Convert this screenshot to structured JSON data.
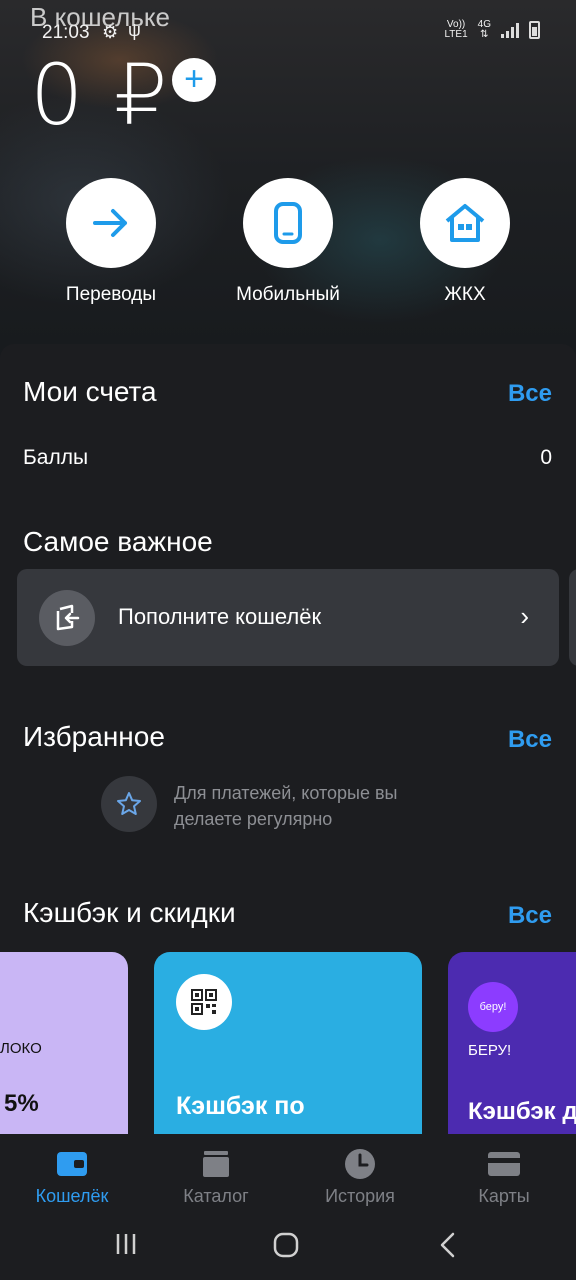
{
  "status_bar": {
    "time": "21:03",
    "network_top": "Vo))",
    "network_bottom": "LTE1",
    "net_type": "4G"
  },
  "header": {
    "caption": "В кошельке",
    "balance": "0 ₽"
  },
  "quick_actions": [
    {
      "label": "Переводы",
      "icon": "arrow-right-icon"
    },
    {
      "label": "Мобильный",
      "icon": "phone-icon"
    },
    {
      "label": "ЖКХ",
      "icon": "house-icon"
    }
  ],
  "accounts": {
    "title": "Мои счета",
    "all": "Все",
    "rows": [
      {
        "label": "Баллы",
        "value": "0"
      }
    ]
  },
  "important": {
    "title": "Самое важное",
    "card_text": "Пополните кошелёк"
  },
  "favorites": {
    "title": "Избранное",
    "all": "Все",
    "hint": "Для платежей, которые вы делаете регулярно"
  },
  "cashback": {
    "title": "Кэшбэк и скидки",
    "all": "Все",
    "cards": [
      {
        "brand": "ЛОКО",
        "percent": "5%"
      },
      {
        "title": "Кэшбэк по"
      },
      {
        "logo": "беру!",
        "brand": "БЕРУ!",
        "title": "Кэшбэк д"
      }
    ]
  },
  "bottom_nav": [
    {
      "label": "Кошелёк",
      "active": true
    },
    {
      "label": "Каталог",
      "active": false
    },
    {
      "label": "История",
      "active": false
    },
    {
      "label": "Карты",
      "active": false
    }
  ],
  "colors": {
    "accent": "#2f9cf0",
    "background": "#1c1d20",
    "card": "#36383d",
    "promo_blue": "#2aaee2",
    "promo_purple": "#4c2bb0",
    "promo_lilac": "#c9b6f5"
  }
}
